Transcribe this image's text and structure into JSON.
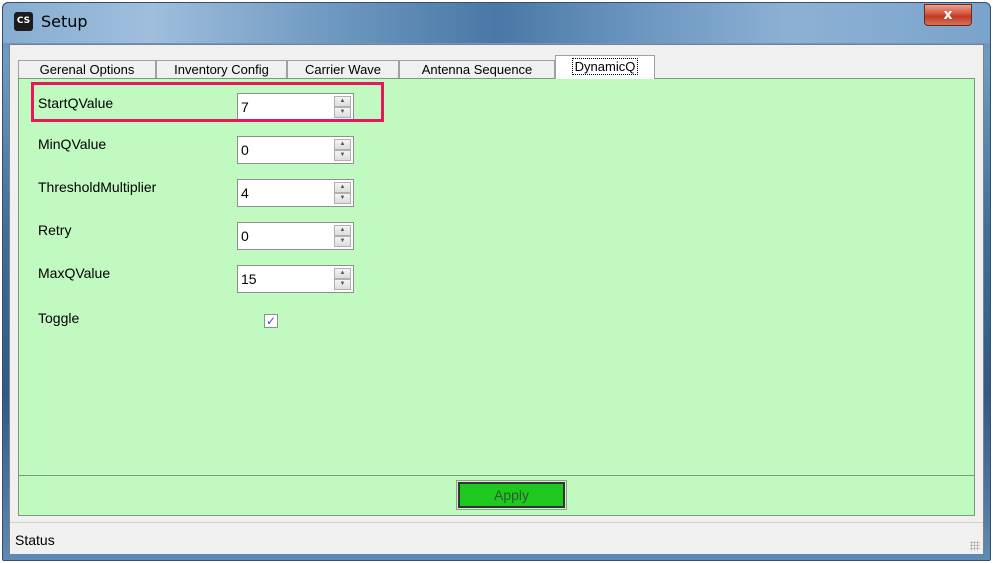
{
  "window": {
    "title": "Setup",
    "icon_text": "CS",
    "close_label": "x"
  },
  "tabs": [
    {
      "label": "Gerenal Options",
      "active": false
    },
    {
      "label": "Inventory Config",
      "active": false
    },
    {
      "label": "Carrier Wave",
      "active": false
    },
    {
      "label": "Antenna Sequence",
      "active": false
    },
    {
      "label": "DynamicQ",
      "active": true
    }
  ],
  "fields": {
    "start_q": {
      "label": "StartQValue",
      "value": "7"
    },
    "min_q": {
      "label": "MinQValue",
      "value": "0"
    },
    "threshold": {
      "label": "ThresholdMultiplier",
      "value": "4"
    },
    "retry": {
      "label": "Retry",
      "value": "0"
    },
    "max_q": {
      "label": "MaxQValue",
      "value": "15"
    },
    "toggle": {
      "label": "Toggle",
      "checked": true
    }
  },
  "apply_label": "Apply",
  "status": "Status",
  "colors": {
    "panel_bg": "#c0fac0",
    "apply_bg": "#1fc81f",
    "highlight": "#e8175d"
  }
}
